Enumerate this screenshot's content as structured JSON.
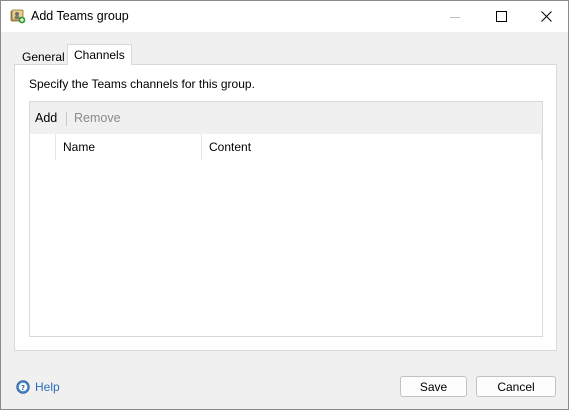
{
  "window": {
    "title": "Add Teams group",
    "icon": "teams-group-icon"
  },
  "tabs": [
    {
      "label": "General",
      "active": false
    },
    {
      "label": "Channels",
      "active": true
    }
  ],
  "channels_panel": {
    "instructions": "Specify the Teams channels for this group.",
    "toolbar": {
      "add_label": "Add",
      "remove_label": "Remove",
      "remove_disabled": true
    },
    "columns": [
      {
        "label": "Name"
      },
      {
        "label": "Content"
      }
    ],
    "rows": []
  },
  "footer": {
    "help_label": "Help",
    "save_label": "Save",
    "cancel_label": "Cancel"
  },
  "colors": {
    "link": "#2b6cbf",
    "disabled_text": "#8a8a8a",
    "panel_border": "#d9d9d9"
  }
}
